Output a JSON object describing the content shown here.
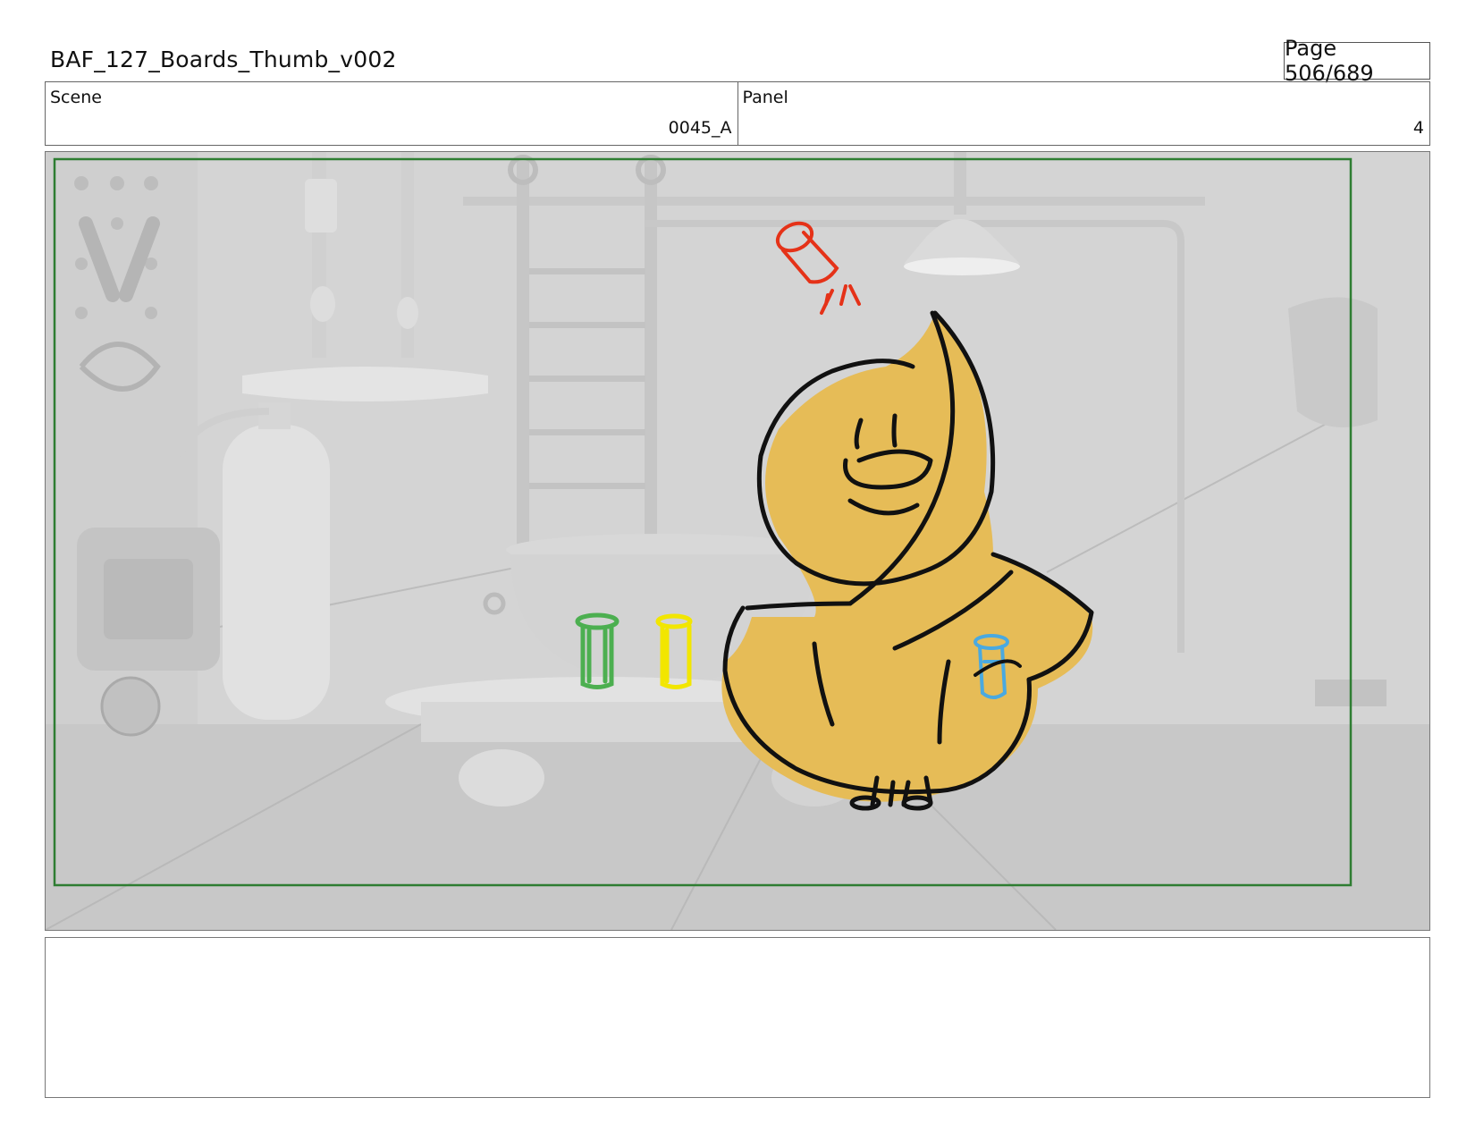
{
  "document": {
    "title": "BAF_127_Boards_Thumb_v002",
    "page": "Page 506/689"
  },
  "info": {
    "scene_label": "Scene",
    "scene_value": "0045_A",
    "panel_label": "Panel",
    "panel_value": "4"
  },
  "panel": {
    "safe_frame_color": "#2e7d32",
    "character_color": "#e6bc57",
    "vial_colors": {
      "green": "#4caf50",
      "yellow": "#f2e600",
      "blue": "#4aa9e0",
      "red": "#e53218"
    }
  },
  "notes": {
    "text": ""
  }
}
